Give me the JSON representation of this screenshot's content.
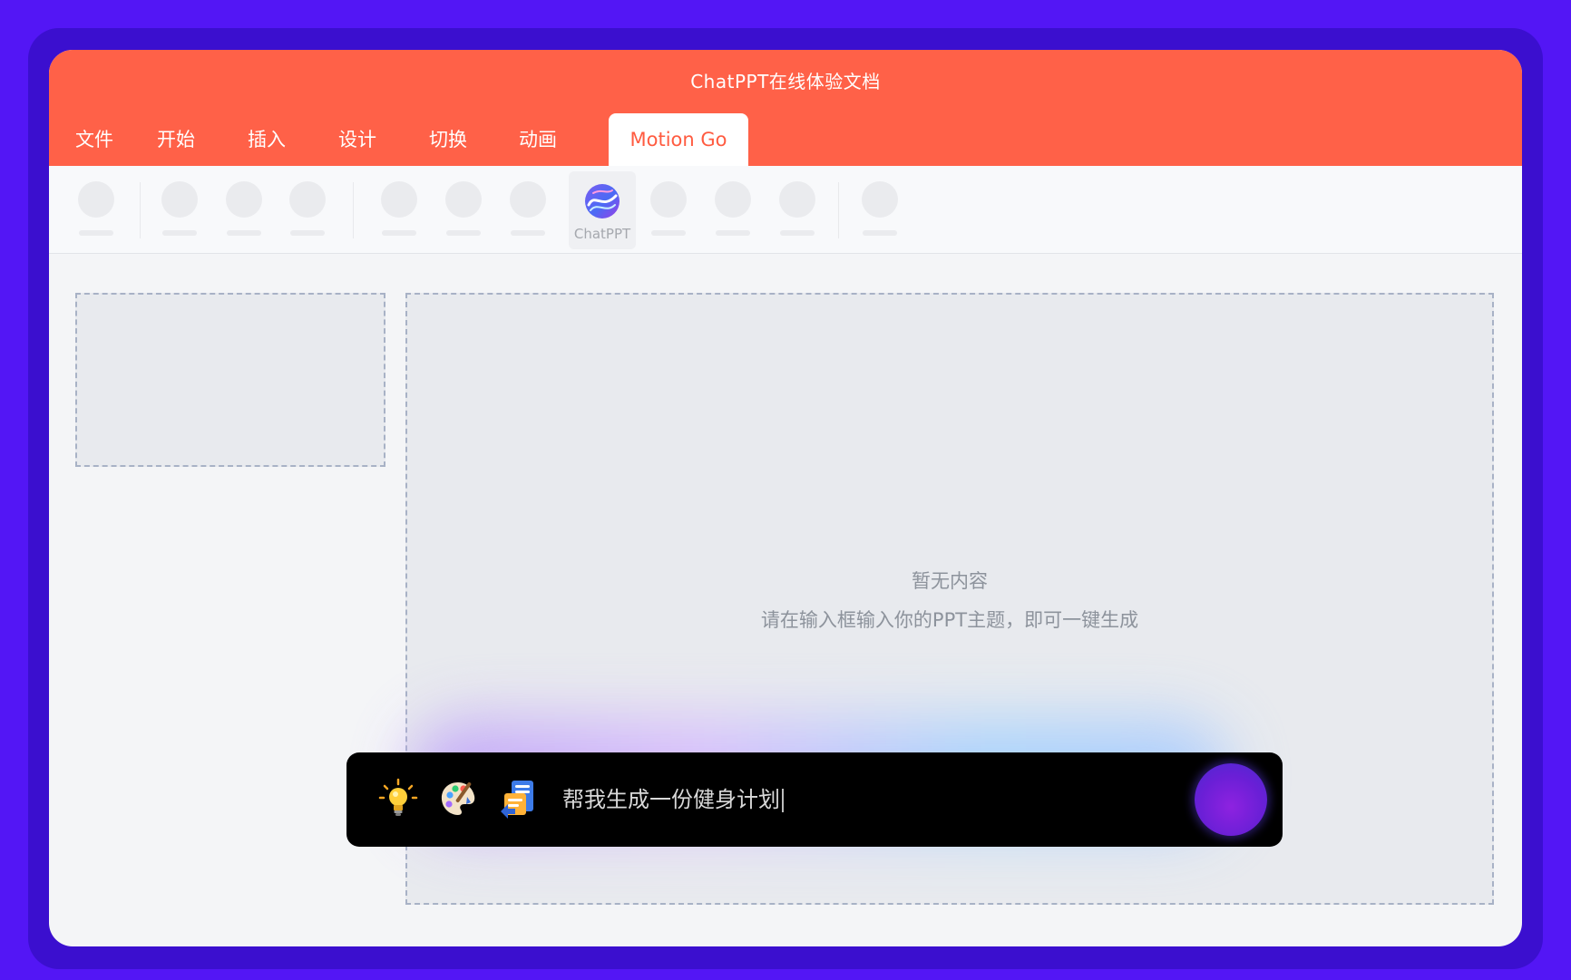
{
  "app": {
    "title": "ChatPPT在线体验文档"
  },
  "menu": {
    "items": [
      {
        "label": "文件"
      },
      {
        "label": "开始"
      },
      {
        "label": "插入"
      },
      {
        "label": "设计"
      },
      {
        "label": "切换"
      },
      {
        "label": "动画"
      },
      {
        "label": "Motion Go",
        "active": true
      }
    ]
  },
  "toolbar": {
    "chatppt_label": "ChatPPT",
    "chatppt_icon": "chatppt-logo-icon"
  },
  "canvas": {
    "empty_title": "暂无内容",
    "empty_hint": "请在输入框输入你的PPT主题，即可一键生成"
  },
  "prompt": {
    "value": "帮我生成一份健身计划",
    "icons": [
      "lightbulb-icon",
      "palette-icon",
      "document-import-icon"
    ],
    "send_icon": "send-orb-icon"
  },
  "colors": {
    "background": "#5316f5",
    "header": "#ff6148",
    "active_tab_text": "#ff5b40",
    "prompt_bar": "#000000"
  }
}
